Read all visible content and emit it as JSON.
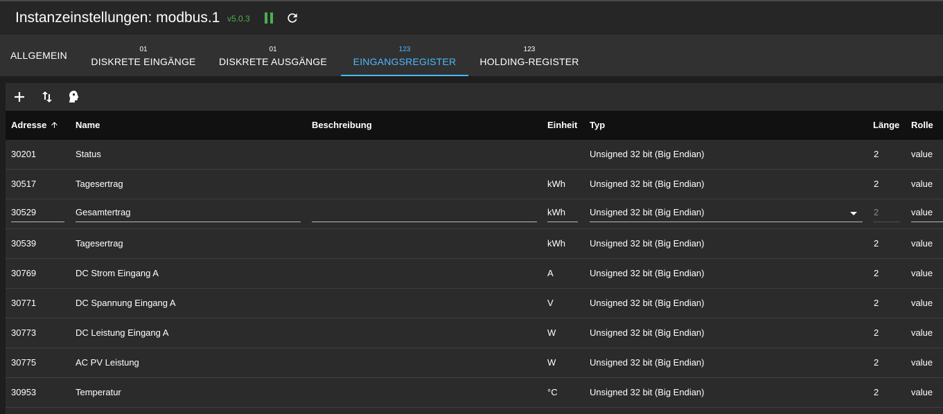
{
  "header": {
    "title": "Instanzeinstellungen: modbus.1",
    "version": "v5.0.3"
  },
  "tabs": [
    {
      "count": "",
      "label": "ALLGEMEIN"
    },
    {
      "count": "01",
      "label": "DISKRETE EINGÄNGE"
    },
    {
      "count": "01",
      "label": "DISKRETE AUSGÄNGE"
    },
    {
      "count": "123",
      "label": "EINGANGSREGISTER"
    },
    {
      "count": "123",
      "label": "HOLDING-REGISTER"
    }
  ],
  "toolbar": {
    "icons": [
      "plus-icon",
      "sort-icon",
      "import-icon"
    ]
  },
  "columns": [
    "Adresse",
    "Name",
    "Beschreibung",
    "Einheit",
    "Typ",
    "Länge",
    "Rolle"
  ],
  "rows": [
    {
      "adresse": "30201",
      "name": "Status",
      "beschreibung": "",
      "einheit": "",
      "typ": "Unsigned 32 bit (Big Endian)",
      "laenge": "2",
      "rolle": "value"
    },
    {
      "adresse": "30517",
      "name": "Tagesertrag",
      "beschreibung": "",
      "einheit": "kWh",
      "typ": "Unsigned 32 bit (Big Endian)",
      "laenge": "2",
      "rolle": "value"
    },
    {
      "adresse": "30529",
      "name": "Gesamtertrag",
      "beschreibung": "",
      "einheit": "kWh",
      "typ": "Unsigned 32 bit (Big Endian)",
      "laenge": "2",
      "rolle": "value",
      "editing": true
    },
    {
      "adresse": "30539",
      "name": "Tagesertrag",
      "beschreibung": "",
      "einheit": "kWh",
      "typ": "Unsigned 32 bit (Big Endian)",
      "laenge": "2",
      "rolle": "value"
    },
    {
      "adresse": "30769",
      "name": "DC Strom Eingang A",
      "beschreibung": "",
      "einheit": "A",
      "typ": "Unsigned 32 bit (Big Endian)",
      "laenge": "2",
      "rolle": "value"
    },
    {
      "adresse": "30771",
      "name": "DC Spannung Eingang A",
      "beschreibung": "",
      "einheit": "V",
      "typ": "Unsigned 32 bit (Big Endian)",
      "laenge": "2",
      "rolle": "value"
    },
    {
      "adresse": "30773",
      "name": "DC Leistung Eingang A",
      "beschreibung": "",
      "einheit": "W",
      "typ": "Unsigned 32 bit (Big Endian)",
      "laenge": "2",
      "rolle": "value"
    },
    {
      "adresse": "30775",
      "name": "AC PV Leistung",
      "beschreibung": "",
      "einheit": "W",
      "typ": "Unsigned 32 bit (Big Endian)",
      "laenge": "2",
      "rolle": "value"
    },
    {
      "adresse": "30953",
      "name": "Temperatur",
      "beschreibung": "",
      "einheit": "°C",
      "typ": "Unsigned 32 bit (Big Endian)",
      "laenge": "2",
      "rolle": "value"
    }
  ]
}
